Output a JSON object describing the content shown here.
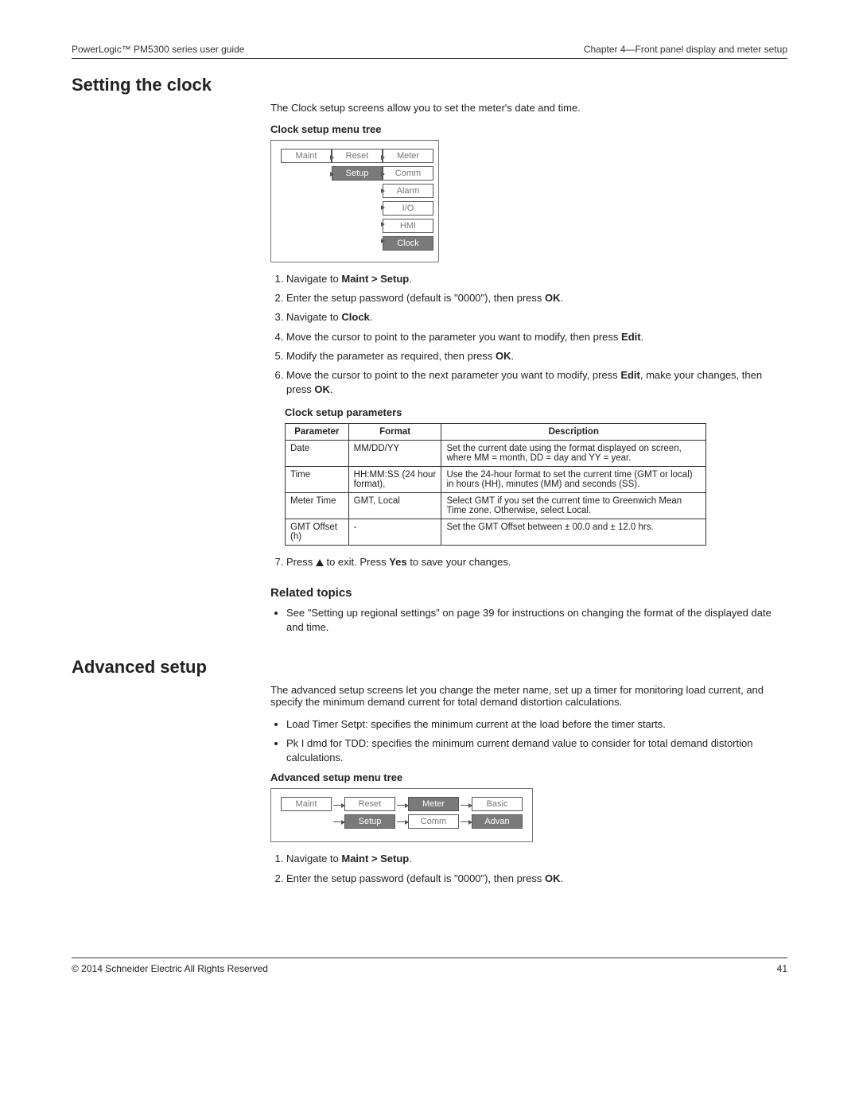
{
  "header": {
    "left": "PowerLogic™ PM5300 series user guide",
    "right": "Chapter 4—Front panel display and meter setup"
  },
  "section1": {
    "title": "Setting the clock",
    "intro": "The Clock setup screens allow you to set the meter's date and time.",
    "tree_title": "Clock setup menu tree",
    "tree": {
      "col1": [
        "Maint"
      ],
      "col2": [
        "Reset",
        "Setup"
      ],
      "col2_selected": 1,
      "col3": [
        "Meter",
        "Comm",
        "Alarm",
        "I/O",
        "HMI",
        "Clock"
      ],
      "col3_selected": 5
    },
    "steps": [
      "Navigate to <b>Maint > Setup</b>.",
      "Enter the setup password (default is \"0000\"), then press <b>OK</b>.",
      "Navigate to <b>Clock</b>.",
      "Move the cursor to point to the parameter you want to modify, then press <b>Edit</b>.",
      "Modify the parameter as required, then press <b>OK</b>.",
      "Move the cursor to point to the next parameter you want to modify, press <b>Edit</b>, make your changes, then press <b>OK</b>."
    ],
    "params_title": "Clock setup parameters",
    "params_headers": [
      "Parameter",
      "Format",
      "Description"
    ],
    "params_rows": [
      [
        "Date",
        "MM/DD/YY",
        "Set the current date using the format displayed on screen, where MM = month, DD = day and YY = year."
      ],
      [
        "Time",
        "HH:MM:SS (24 hour format),",
        "Use the 24-hour format to set the current time (GMT or local) in hours (HH), minutes (MM) and seconds (SS)."
      ],
      [
        "Meter Time",
        "GMT, Local",
        "Select GMT if you set the current time to Greenwich Mean Time zone. Otherwise, select Local."
      ],
      [
        "GMT Offset (h)",
        "-",
        "Set the GMT Offset between ± 00.0 and ± 12.0 hrs."
      ]
    ],
    "step7_pre": "Press ",
    "step7_post": " to exit. Press ",
    "step7_yes": "Yes",
    "step7_end": " to save your changes.",
    "related_title": "Related topics",
    "related_item": "See \"Setting up regional settings\" on page 39 for instructions on changing the format of the displayed date and time.",
    "exit_icon": "up-triangle-icon"
  },
  "section2": {
    "title": "Advanced setup",
    "intro": "The advanced setup screens let you change the meter name, set up a timer for monitoring load current, and specify the minimum demand current for total demand distortion calculations.",
    "bullets": [
      "Load Timer Setpt: specifies the minimum current at the load before the timer starts.",
      "Pk I dmd for TDD: specifies the minimum current demand value to consider for total demand distortion calculations."
    ],
    "tree_title": "Advanced setup menu tree",
    "tree": {
      "col1": [
        "Maint"
      ],
      "col2": [
        "Reset",
        "Setup"
      ],
      "col2_selected": 1,
      "col3": [
        "Meter",
        "Comm"
      ],
      "col3_selected": 0,
      "col4": [
        "Basic",
        "Advan"
      ],
      "col4_selected": 1
    },
    "steps": [
      "Navigate to <b>Maint > Setup</b>.",
      "Enter the setup password (default is \"0000\"), then press <b>OK</b>."
    ]
  },
  "footer": {
    "left": "© 2014 Schneider Electric All Rights Reserved",
    "right": "41"
  }
}
